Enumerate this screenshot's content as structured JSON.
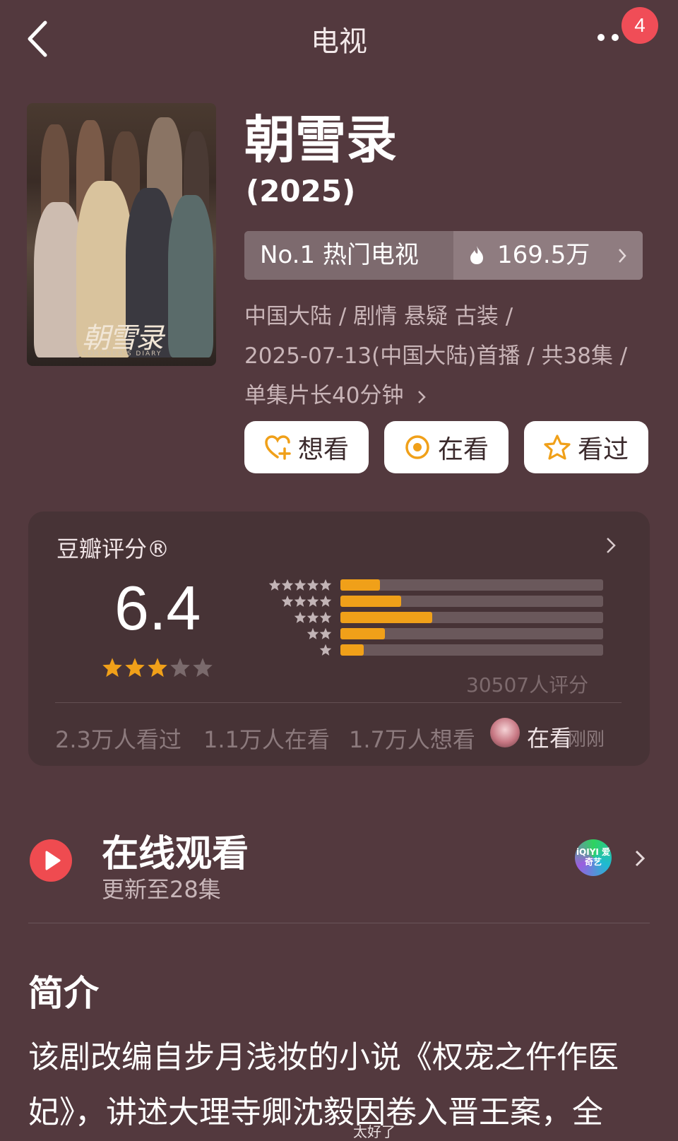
{
  "header": {
    "title": "电视",
    "notification_count": "4"
  },
  "movie": {
    "title": "朝雪录",
    "year": "(2025)",
    "poster_title": "朝雪录",
    "poster_subtitle": "CORONER'S DIARY",
    "rank_label": "No.1 热门电视",
    "heat_value": "169.5万",
    "meta_line1": "中国大陆 / 剧情 悬疑 古装 /",
    "meta_line2": "2025-07-13(中国大陆)首播 / 共38集 /",
    "meta_line3": "单集片长40分钟"
  },
  "actions": {
    "want": "想看",
    "watching": "在看",
    "watched": "看过"
  },
  "rating": {
    "label": "豆瓣评分®",
    "score": "6.4",
    "stars": 3,
    "distribution": [
      {
        "stars": 5,
        "fraction": 0.15
      },
      {
        "stars": 4,
        "fraction": 0.23
      },
      {
        "stars": 3,
        "fraction": 0.35
      },
      {
        "stars": 2,
        "fraction": 0.17
      },
      {
        "stars": 1,
        "fraction": 0.09
      }
    ],
    "votes": "30507人评分",
    "stats": {
      "watched": "2.3万人看过",
      "watching": "1.1万人在看",
      "want": "1.7万人想看"
    },
    "friend_status": "在看",
    "friend_time": "刚刚"
  },
  "online": {
    "title": "在线观看",
    "subtitle": "更新至28集",
    "provider_label": "iQIYI 爱奇艺"
  },
  "intro": {
    "heading": "简介",
    "text": "该剧改编自步月浅妆的小说《权宠之仵作医妃》，讲述大理寺卿沈毅因卷入晋王案，全"
  },
  "watermark": "太好了",
  "colors": {
    "background": "#53393e",
    "accent_orange": "#f0a019",
    "play_red": "#ef4b50"
  }
}
